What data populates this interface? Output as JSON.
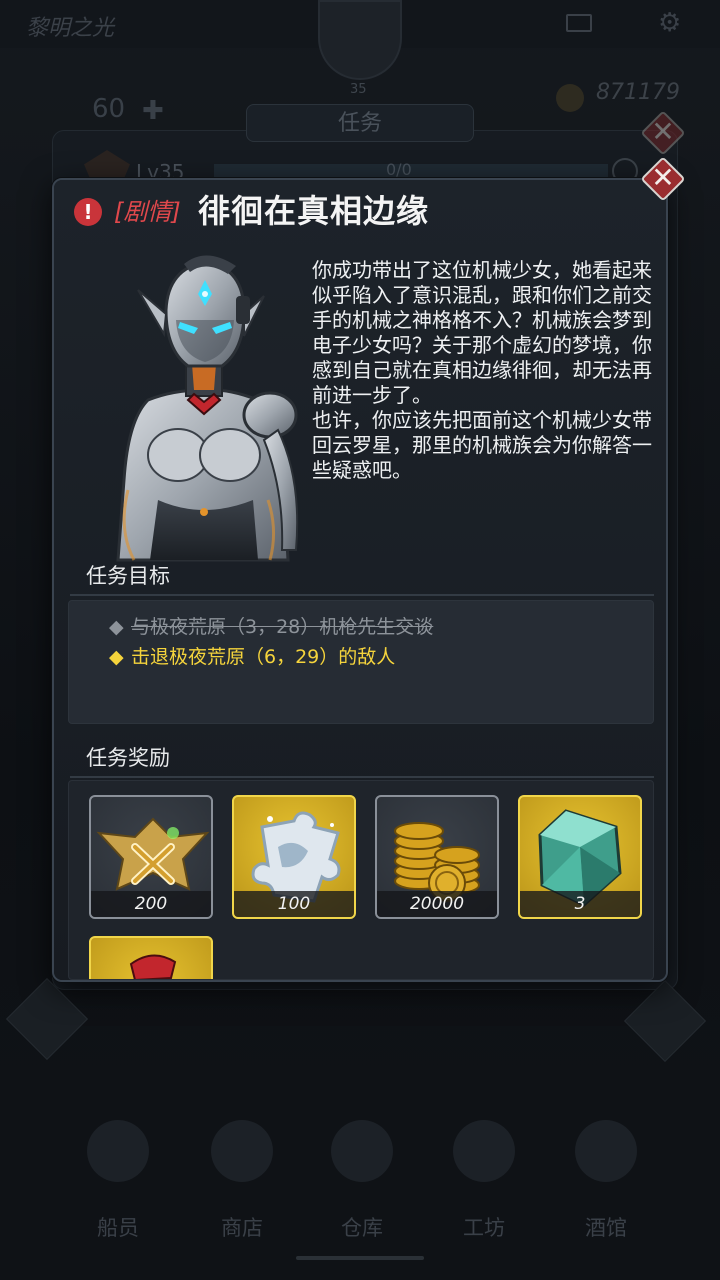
{
  "background": {
    "app_title": "黎明之光",
    "player_level_badge": "35",
    "left_stat": "60",
    "coins": "871179",
    "panel_tab": "任务",
    "panel_level": "Lv35",
    "panel_progress": "0/0",
    "nav": [
      "船员",
      "商店",
      "仓库",
      "工坊",
      "酒馆"
    ]
  },
  "dialog": {
    "tag": "[剧情]",
    "title": "徘徊在真相边缘",
    "story": "你成功带出了这位机械少女，她看起来似乎陷入了意识混乱，跟和你们之前交手的机械之神格格不入？机械族会梦到电子少女吗？关于那个虚幻的梦境，你感到自己就在真相边缘徘徊，却无法再前进一步了。\n也许，你应该先把面前这个机械少女带回云罗星，那里的机械族会为你解答一些疑惑吧。",
    "objectives_header": "任务目标",
    "objectives": [
      {
        "bullet": "◆",
        "text": "与极夜荒原（3，28）机枪先生交谈",
        "status": "done"
      },
      {
        "bullet": "◆",
        "text": "击退极夜荒原（6，29）的敌人",
        "status": "active"
      }
    ],
    "rewards_header": "任务奖励",
    "rewards": [
      {
        "icon": "rank-medal-icon",
        "count": "200",
        "frame": "gray"
      },
      {
        "icon": "puzzle-fragment-icon",
        "count": "100",
        "frame": "gold"
      },
      {
        "icon": "gold-coins-icon",
        "count": "20000",
        "frame": "gray"
      },
      {
        "icon": "green-crystal-icon",
        "count": "3",
        "frame": "gold"
      },
      {
        "icon": "red-crystal-icon",
        "count": "",
        "frame": "gold"
      }
    ]
  },
  "colors": {
    "accent_red": "#e0484c",
    "objective_active": "#f5d43c",
    "objective_done": "#8d939a",
    "gold_frame": "#e7c330"
  }
}
